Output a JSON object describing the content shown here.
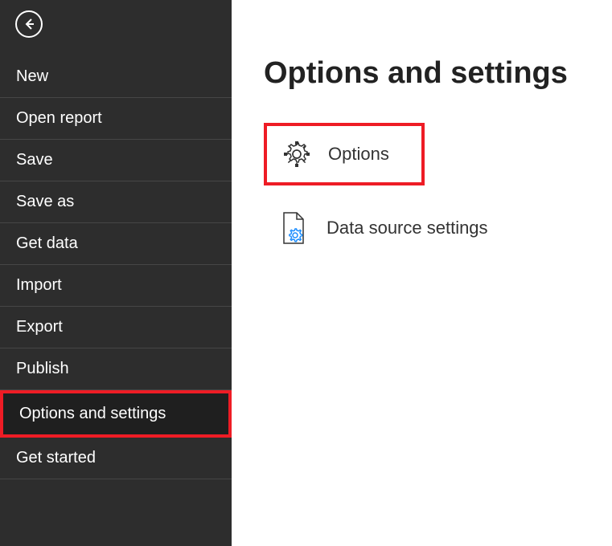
{
  "sidebar": {
    "items": [
      {
        "label": "New"
      },
      {
        "label": "Open report"
      },
      {
        "label": "Save"
      },
      {
        "label": "Save as"
      },
      {
        "label": "Get data"
      },
      {
        "label": "Import"
      },
      {
        "label": "Export"
      },
      {
        "label": "Publish"
      },
      {
        "label": "Options and settings"
      },
      {
        "label": "Get started"
      }
    ]
  },
  "content": {
    "title": "Options and settings",
    "options_label": "Options",
    "datasource_label": "Data source settings"
  }
}
